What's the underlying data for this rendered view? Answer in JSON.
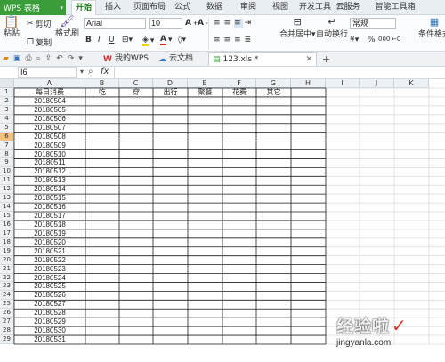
{
  "app": {
    "name": "WPS 表格"
  },
  "menu": {
    "tabs": [
      "开始",
      "插入",
      "页面布局",
      "公式",
      "数据",
      "审阅",
      "视图",
      "开发工具",
      "云服务",
      "智能工具箱"
    ],
    "active": "开始"
  },
  "ribbon": {
    "paste": "粘贴",
    "cut": "剪切",
    "copy": "复制",
    "format_painter": "格式刷",
    "font_name": "Arial",
    "font_size": "10",
    "bold": "B",
    "italic": "I",
    "underline": "U",
    "font_color_letter": "A",
    "merge_center": "合并居中",
    "wrap_text": "自动换行",
    "number_format": "常规",
    "percent": "%",
    "thousands": "000",
    "conditional_format": "条件格式"
  },
  "tabs": {
    "my_wps": "我的WPS",
    "cloud_docs": "云文档",
    "file": "123.xls *",
    "add": "+"
  },
  "formula_bar": {
    "cell_ref": "I6",
    "fx": "fx",
    "content": ""
  },
  "sheet": {
    "columns": [
      "A",
      "B",
      "C",
      "D",
      "E",
      "F",
      "G",
      "H",
      "I",
      "J",
      "K"
    ],
    "headers": [
      "每日消费",
      "吃",
      "穿",
      "出行",
      "聚餐",
      "花费",
      "其它"
    ],
    "dates": [
      "20180504",
      "20180505",
      "20180506",
      "20180507",
      "20180508",
      "20180509",
      "20180510",
      "20180511",
      "20180512",
      "20180513",
      "20180514",
      "20180515",
      "20180516",
      "20180517",
      "20180518",
      "20180519",
      "20180520",
      "20180521",
      "20180522",
      "20180523",
      "20180524",
      "20180525",
      "20180526",
      "20180527",
      "20180528",
      "20180529",
      "20180530",
      "20180531"
    ],
    "selected_row": "6"
  },
  "watermark": {
    "text": "经验啦",
    "url": "jingyanla.com"
  },
  "colors": {
    "accent": "#3a9d3a",
    "selected_header": "#f4c27a"
  }
}
